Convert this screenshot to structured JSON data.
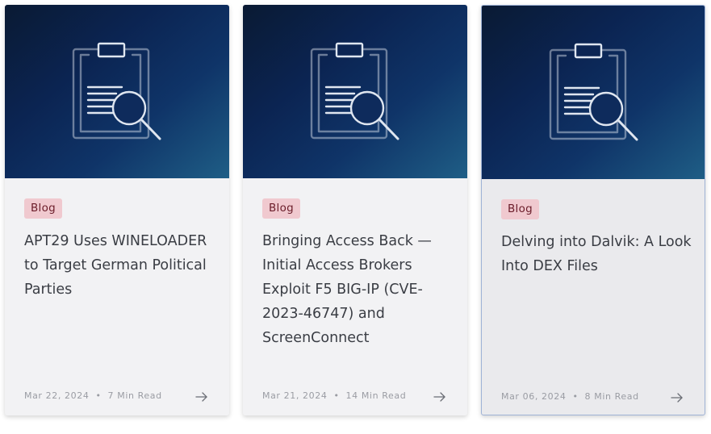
{
  "cards": [
    {
      "tag": "Blog",
      "title": "APT29 Uses WINELOADER to Target German Political Parties",
      "date": "Mar 22, 2024",
      "separator": "•",
      "read_time": "7 Min Read",
      "icon": "clipboard-search-icon"
    },
    {
      "tag": "Blog",
      "title": "Bringing Access Back — Initial Access Brokers Exploit F5 BIG-IP (CVE-2023-46747) and ScreenConnect",
      "date": "Mar 21, 2024",
      "separator": "•",
      "read_time": "14 Min Read",
      "icon": "clipboard-search-icon"
    },
    {
      "tag": "Blog",
      "title": "Delving into Dalvik: A Look Into DEX Files",
      "date": "Mar 06, 2024",
      "separator": "•",
      "read_time": "8 Min Read",
      "icon": "clipboard-search-icon"
    }
  ],
  "colors": {
    "badge_bg": "#f0c9cf",
    "badge_text": "#6b1d2a",
    "hero_dark": "#0a1a33",
    "hero_light": "#1f5e86"
  }
}
